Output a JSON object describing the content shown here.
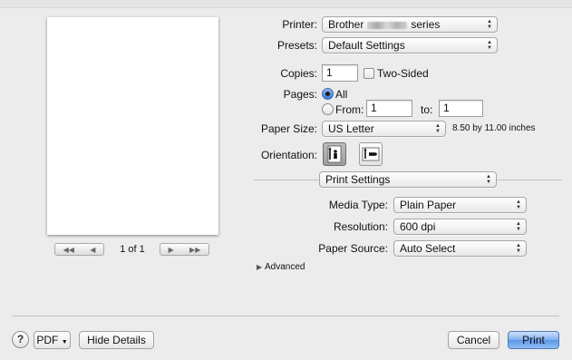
{
  "preview": {
    "page_indicator": "1 of 1"
  },
  "printer": {
    "label": "Printer:",
    "value_prefix": "Brother",
    "value_suffix": "series"
  },
  "presets": {
    "label": "Presets:",
    "value": "Default Settings"
  },
  "copies": {
    "label": "Copies:",
    "value": "1",
    "two_sided_label": "Two-Sided",
    "two_sided_checked": false
  },
  "pages": {
    "label": "Pages:",
    "all_label": "All",
    "all_selected": true,
    "from_label": "From:",
    "from_value": "1",
    "to_label": "to:",
    "to_value": "1"
  },
  "paper_size": {
    "label": "Paper Size:",
    "value": "US Letter",
    "dimensions": "8.50 by 11.00 inches"
  },
  "orientation": {
    "label": "Orientation:",
    "selected": "portrait"
  },
  "section_popup": {
    "value": "Print Settings"
  },
  "media_type": {
    "label": "Media Type:",
    "value": "Plain Paper"
  },
  "resolution": {
    "label": "Resolution:",
    "value": "600 dpi"
  },
  "paper_source": {
    "label": "Paper Source:",
    "value": "Auto Select"
  },
  "advanced": {
    "label": "Advanced"
  },
  "footer": {
    "help": "?",
    "pdf": "PDF",
    "hide_details": "Hide Details",
    "cancel": "Cancel",
    "print": "Print"
  }
}
